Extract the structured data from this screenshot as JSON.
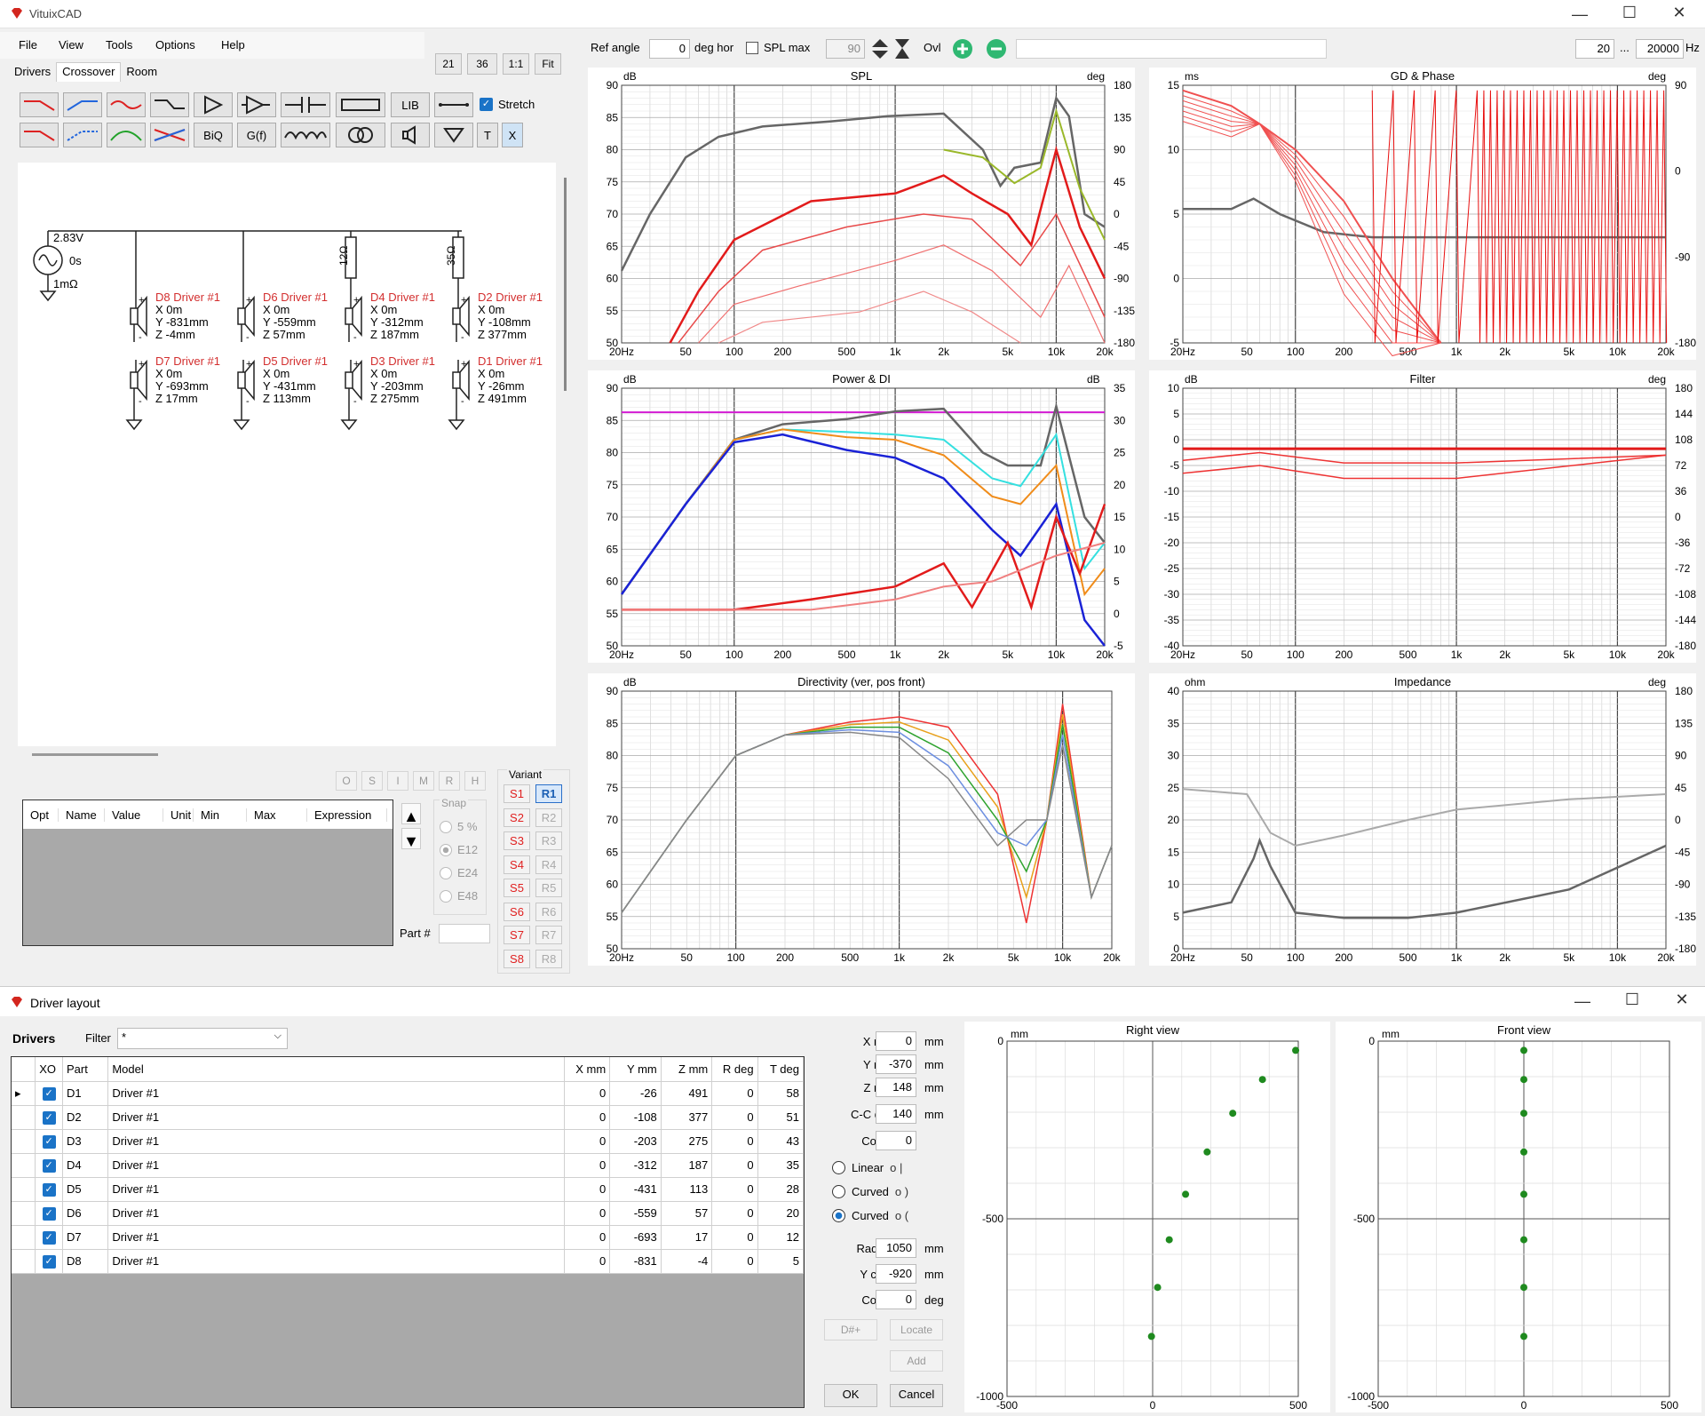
{
  "app": {
    "title": "VituixCAD"
  },
  "menu": [
    "File",
    "View",
    "Tools",
    "Options",
    "Help"
  ],
  "tabs": [
    "Drivers",
    "Crossover",
    "Room"
  ],
  "zoom_buttons": [
    "21",
    "36",
    "1:1",
    "Fit"
  ],
  "toolbar": {
    "ref_angle_label": "Ref angle",
    "ref_angle_value": "0",
    "deg_hor": "deg hor",
    "spl_max_label": "SPL max",
    "spl_max_value": "90",
    "ovl_label": "Ovl",
    "f_start": "20",
    "f_sep": "...",
    "f_end": "20000",
    "f_unit": "Hz"
  },
  "palette": {
    "stretch": "Stretch",
    "biq": "BiQ",
    "gf": "G(f)",
    "lib": "LIB",
    "t": "T",
    "x": "X"
  },
  "schematic": {
    "source": [
      "2.83V",
      "0s",
      "1mΩ"
    ],
    "resistors": [
      "12Ω",
      "35Ω"
    ],
    "top_row": [
      {
        "name": "D8 Driver #1",
        "x": "X 0m",
        "y": "Y -831mm",
        "z": "Z -4mm"
      },
      {
        "name": "D6 Driver #1",
        "x": "X 0m",
        "y": "Y -559mm",
        "z": "Z 57mm"
      },
      {
        "name": "D4 Driver #1",
        "x": "X 0m",
        "y": "Y -312mm",
        "z": "Z 187mm"
      },
      {
        "name": "D2 Driver #1",
        "x": "X 0m",
        "y": "Y -108mm",
        "z": "Z 377mm"
      }
    ],
    "bottom_row": [
      {
        "name": "D7 Driver #1",
        "x": "X 0m",
        "y": "Y -693mm",
        "z": "Z 17mm"
      },
      {
        "name": "D5 Driver #1",
        "x": "X 0m",
        "y": "Y -431mm",
        "z": "Z 113mm"
      },
      {
        "name": "D3 Driver #1",
        "x": "X 0m",
        "y": "Y -203mm",
        "z": "Z 275mm"
      },
      {
        "name": "D1 Driver #1",
        "x": "X 0m",
        "y": "Y -26mm",
        "z": "Z 491mm"
      }
    ]
  },
  "osi_buttons": [
    "O",
    "S",
    "I",
    "M",
    "R",
    "H"
  ],
  "param_table_headers": [
    "Opt",
    "Name",
    "Value",
    "Unit",
    "Min",
    "Max",
    "Expression"
  ],
  "snap": {
    "label": "Snap",
    "options": [
      "5 %",
      "E12",
      "E24",
      "E48"
    ],
    "selected": "E12"
  },
  "part_label": "Part #",
  "variant": {
    "label": "Variant",
    "s": [
      "S1",
      "S2",
      "S3",
      "S4",
      "S5",
      "S6",
      "S7",
      "S8"
    ],
    "r": [
      "R1",
      "R2",
      "R3",
      "R4",
      "R5",
      "R6",
      "R7",
      "R8"
    ]
  },
  "charts": {
    "spl": {
      "title": "SPL",
      "lunit": "dB",
      "runit": "deg",
      "yl": [
        "90",
        "85",
        "80",
        "75",
        "70",
        "65",
        "60",
        "55",
        "50"
      ],
      "yr": [
        "180",
        "135",
        "90",
        "45",
        "0",
        "-45",
        "-90",
        "-135",
        "-180"
      ]
    },
    "gd": {
      "title": "GD & Phase",
      "lunit": "ms",
      "runit": "deg",
      "yl": [
        "15",
        "10",
        "5",
        "0",
        "-5"
      ],
      "yr": [
        "90",
        "0",
        "-90",
        "-180"
      ]
    },
    "power": {
      "title": "Power & DI",
      "lunit": "dB",
      "runit": "dB",
      "yl": [
        "90",
        "85",
        "80",
        "75",
        "70",
        "65",
        "60",
        "55",
        "50"
      ],
      "yr": [
        "35",
        "30",
        "25",
        "20",
        "15",
        "10",
        "5",
        "0",
        "-5"
      ]
    },
    "filter": {
      "title": "Filter",
      "lunit": "dB",
      "runit": "deg",
      "yl": [
        "10",
        "5",
        "0",
        "-5",
        "-10",
        "-15",
        "-20",
        "-25",
        "-30",
        "-35",
        "-40"
      ],
      "yr": [
        "180",
        "144",
        "108",
        "72",
        "36",
        "0",
        "-36",
        "-72",
        "-108",
        "-144",
        "-180"
      ]
    },
    "dir": {
      "title": "Directivity (ver, pos front)",
      "lunit": "dB",
      "runit": "",
      "yl": [
        "90",
        "85",
        "80",
        "75",
        "70",
        "65",
        "60",
        "55",
        "50"
      ],
      "yr": []
    },
    "imp": {
      "title": "Impedance",
      "lunit": "ohm",
      "runit": "deg",
      "yl": [
        "40",
        "35",
        "30",
        "25",
        "20",
        "15",
        "10",
        "5",
        "0"
      ],
      "yr": [
        "180",
        "135",
        "90",
        "45",
        "0",
        "-45",
        "-90",
        "-135",
        "-180"
      ]
    },
    "xticks": [
      "20Hz",
      "50",
      "100",
      "200",
      "500",
      "1k",
      "2k",
      "5k",
      "10k",
      "20k"
    ]
  },
  "driver_layout": {
    "title": "Driver layout",
    "drivers_label": "Drivers",
    "filter_label": "Filter",
    "filter_value": "*",
    "headers": [
      "XO",
      "Part",
      "Model",
      "X mm",
      "Y mm",
      "Z mm",
      "R deg",
      "T deg"
    ],
    "rows": [
      {
        "part": "D1",
        "model": "Driver #1",
        "x": "0",
        "y": "-26",
        "z": "491",
        "r": "0",
        "t": "58"
      },
      {
        "part": "D2",
        "model": "Driver #1",
        "x": "0",
        "y": "-108",
        "z": "377",
        "r": "0",
        "t": "51"
      },
      {
        "part": "D3",
        "model": "Driver #1",
        "x": "0",
        "y": "-203",
        "z": "275",
        "r": "0",
        "t": "43"
      },
      {
        "part": "D4",
        "model": "Driver #1",
        "x": "0",
        "y": "-312",
        "z": "187",
        "r": "0",
        "t": "35"
      },
      {
        "part": "D5",
        "model": "Driver #1",
        "x": "0",
        "y": "-431",
        "z": "113",
        "r": "0",
        "t": "28"
      },
      {
        "part": "D6",
        "model": "Driver #1",
        "x": "0",
        "y": "-559",
        "z": "57",
        "r": "0",
        "t": "20"
      },
      {
        "part": "D7",
        "model": "Driver #1",
        "x": "0",
        "y": "-693",
        "z": "17",
        "r": "0",
        "t": "12"
      },
      {
        "part": "D8",
        "model": "Driver #1",
        "x": "0",
        "y": "-831",
        "z": "-4",
        "r": "0",
        "t": "5"
      }
    ],
    "params": [
      {
        "label": "X mid",
        "value": "0",
        "unit": "mm"
      },
      {
        "label": "Y mid",
        "value": "-370",
        "unit": "mm"
      },
      {
        "label": "Z mid",
        "value": "148",
        "unit": "mm"
      },
      {
        "label": "C-C dist",
        "value": "140",
        "unit": "mm"
      },
      {
        "label": "Count",
        "value": "0",
        "unit": ""
      }
    ],
    "radios": [
      "Linear",
      "Curved",
      "Curved"
    ],
    "radio_glyphs": [
      "o |",
      "o )",
      "o ("
    ],
    "params2": [
      {
        "label": "Radius",
        "value": "1050",
        "unit": "mm"
      },
      {
        "label": "Y cent",
        "value": "-920",
        "unit": "mm"
      },
      {
        "label": "Cover",
        "value": "0",
        "unit": "deg"
      }
    ],
    "buttons": {
      "dplus": "D#+",
      "locate": "Locate",
      "add": "Add",
      "ok": "OK",
      "cancel": "Cancel"
    },
    "right_view": {
      "title": "Right view",
      "unit": "mm",
      "y_labels": [
        "0",
        "-500",
        "-1000"
      ],
      "x_labels": [
        "-500",
        "0",
        "500"
      ]
    },
    "front_view": {
      "title": "Front view",
      "unit": "mm",
      "y_labels": [
        "0",
        "-500",
        "-1000"
      ],
      "x_labels": [
        "-500",
        "0",
        "500"
      ]
    }
  }
}
